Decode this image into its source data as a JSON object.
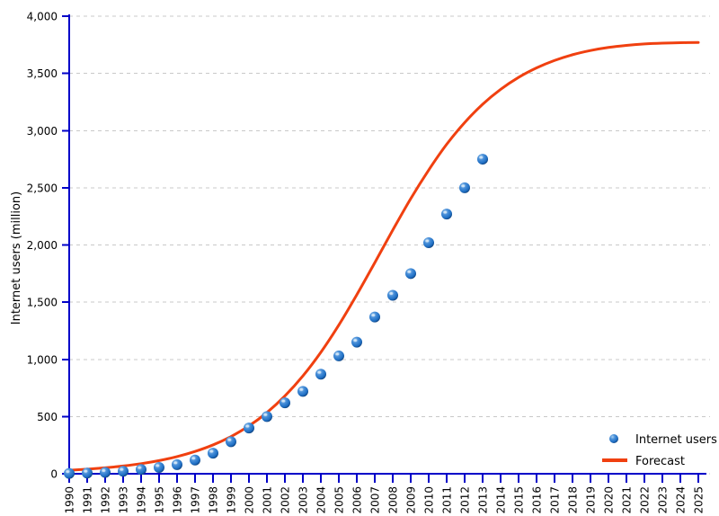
{
  "chart_data": {
    "type": "scatter",
    "title": "",
    "xlabel": "",
    "ylabel": "Internet users (million)",
    "xlim": [
      1990,
      2025
    ],
    "ylim": [
      0,
      4000
    ],
    "grid": true,
    "legend_position": "bottom-right",
    "y_ticks": [
      0,
      500,
      1000,
      1500,
      2000,
      2500,
      3000,
      3500,
      4000
    ],
    "y_tick_labels": [
      "0",
      "500",
      "1,000",
      "1,500",
      "2,000",
      "2,500",
      "3,000",
      "3,500",
      "4,000"
    ],
    "x_ticks": [
      1990,
      1991,
      1992,
      1993,
      1994,
      1995,
      1996,
      1997,
      1998,
      1999,
      2000,
      2001,
      2002,
      2003,
      2004,
      2005,
      2006,
      2007,
      2008,
      2009,
      2010,
      2011,
      2012,
      2013,
      2014,
      2015,
      2016,
      2017,
      2018,
      2019,
      2020,
      2021,
      2022,
      2023,
      2024,
      2025
    ],
    "x_tick_labels": [
      "1990",
      "1991",
      "1992",
      "1993",
      "1994",
      "1995",
      "1996",
      "1997",
      "1998",
      "1999",
      "2000",
      "2001",
      "2002",
      "2003",
      "2004",
      "2005",
      "2006",
      "2007",
      "2008",
      "2009",
      "2010",
      "2011",
      "2012",
      "2013",
      "2014",
      "2015",
      "2016",
      "2017",
      "2018",
      "2019",
      "2020",
      "2021",
      "2022",
      "2023",
      "2024",
      "2025"
    ],
    "series": [
      {
        "name": "Internet users",
        "type": "scatter",
        "marker": "sphere",
        "color": "#1f6fc4",
        "x": [
          1990,
          1991,
          1992,
          1993,
          1994,
          1995,
          1996,
          1997,
          1998,
          1999,
          2000,
          2001,
          2002,
          2003,
          2004,
          2005,
          2006,
          2007,
          2008,
          2009,
          2010,
          2011,
          2012,
          2013
        ],
        "values": [
          3,
          6,
          12,
          22,
          37,
          55,
          80,
          120,
          180,
          280,
          400,
          500,
          620,
          720,
          870,
          1030,
          1150,
          1370,
          1560,
          1750,
          2020,
          2270,
          2500,
          2750
        ]
      },
      {
        "name": "Forecast",
        "type": "line",
        "color": "#f04010",
        "x": [
          1990,
          1991,
          1992,
          1993,
          1994,
          1995,
          1996,
          1997,
          1998,
          1999,
          2000,
          2001,
          2002,
          2003,
          2004,
          2005,
          2006,
          2007,
          2008,
          2009,
          2010,
          2011,
          2012,
          2013,
          2014,
          2015,
          2016,
          2017,
          2018,
          2019,
          2020,
          2021,
          2022,
          2023,
          2024,
          2025
        ],
        "values": [
          30,
          40,
          52,
          68,
          88,
          115,
          150,
          195,
          252,
          325,
          418,
          535,
          680,
          855,
          1062,
          1300,
          1565,
          1845,
          2130,
          2405,
          2655,
          2880,
          3070,
          3230,
          3360,
          3465,
          3548,
          3613,
          3663,
          3700,
          3727,
          3745,
          3757,
          3764,
          3768,
          3770
        ]
      }
    ]
  },
  "legend": {
    "entries": [
      {
        "label": "Internet users",
        "marker": "sphere",
        "color": "#1f6fc4"
      },
      {
        "label": "Forecast",
        "marker": "line",
        "color": "#f04010"
      }
    ]
  },
  "colors": {
    "axis": "#0000c8",
    "gridline": "#c8c8c8",
    "marker": "#1f6fc4",
    "forecast": "#f04010",
    "background": "#ffffff",
    "text": "#000000"
  }
}
